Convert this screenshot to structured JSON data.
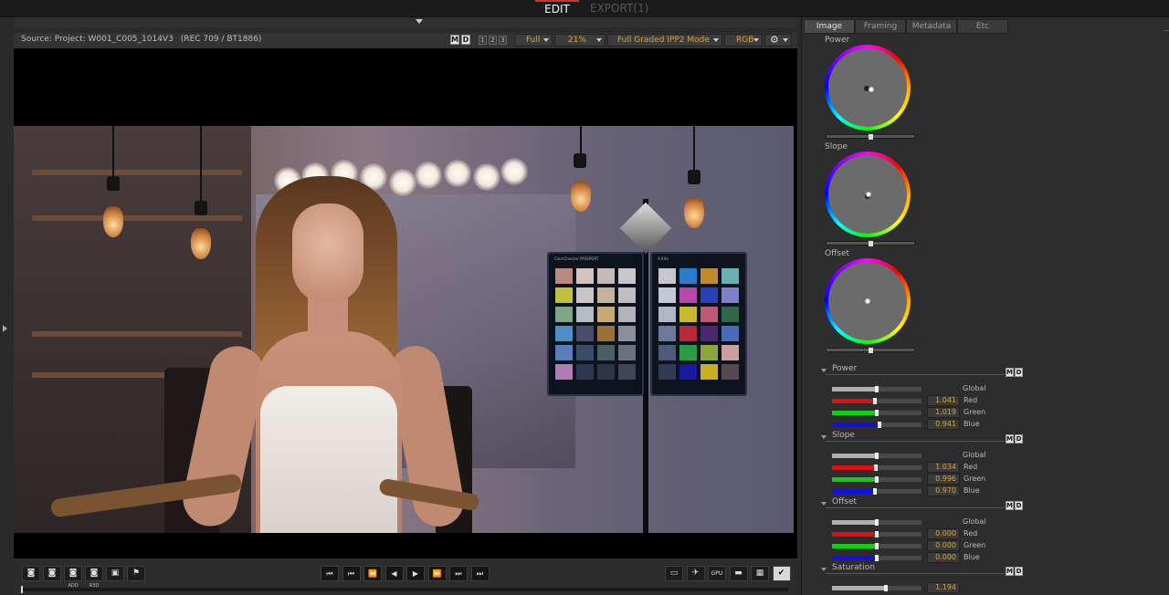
{
  "top": {
    "edit_label": "EDIT",
    "export_label": "EXPORT(1)"
  },
  "viewer_header": {
    "source_label": "Source: Project: W001_C005_1014V3",
    "color_space": "(REC 709 / BT1886)",
    "m_label": "M",
    "d_label": "D",
    "nums": [
      "1",
      "2",
      "3"
    ],
    "res_value": "Full",
    "zoom_value": "21%",
    "mode_value": "Full Graded IPP2 Mode",
    "channel_value": "RGB",
    "gear_icon": "gear-icon"
  },
  "checker_colors_left": [
    "#b78a80",
    "#d6c3bd",
    "#c9b9b6",
    "#c8c6c9",
    "#c2c13e",
    "#c8c4c8",
    "#c6b29a",
    "#c1bec0",
    "#7da686",
    "#b9bbc4",
    "#c4aa74",
    "#b2b4b8",
    "#4b8fc4",
    "#4a4d6a",
    "#9a7038",
    "#8a8e96",
    "#5a7fb8",
    "#3a4c68",
    "#4a6060",
    "#6a7280",
    "#b07cb4",
    "#2a3850",
    "#303648",
    "#3e4658"
  ],
  "checker_colors_right": [
    "#c8c6cc",
    "#2a7cc8",
    "#c08a28",
    "#6ab0b0",
    "#c2c8d4",
    "#b848a8",
    "#2a40b8",
    "#8080c8",
    "#b0b8c8",
    "#c8b830",
    "#c05878",
    "#2e6848",
    "#6e7898",
    "#b82a3a",
    "#4a2870",
    "#4a6cb8",
    "#4e5a78",
    "#2a9a48",
    "#8aa83a",
    "#c8a0a0",
    "#303a52",
    "#1a1aa0",
    "#c8b020",
    "#5a4850"
  ],
  "checker_labels": [
    "ColorChecker PASSPORT",
    "X-Rite"
  ],
  "transport": {
    "left_buttons": [
      {
        "icon": "snapshot-icon",
        "label": ""
      },
      {
        "icon": "camera-icon",
        "label": ""
      },
      {
        "icon": "camera-add-icon",
        "label": "ADD"
      },
      {
        "icon": "camera-r3d-icon",
        "label": "R3D"
      },
      {
        "icon": "frame-icon",
        "label": ""
      },
      {
        "icon": "flag-icon",
        "label": ""
      }
    ],
    "play_glyphs": [
      "⏮",
      "⏮",
      "⏪",
      "◀",
      "▶",
      "⏩",
      "⏭",
      "⏭"
    ],
    "right_buttons": [
      {
        "icon": "monitor-icon",
        "glyph": "▭"
      },
      {
        "icon": "rocket-icon",
        "glyph": "✈"
      },
      {
        "icon": "gpu-icon",
        "glyph": "GPU"
      },
      {
        "icon": "ruler-icon",
        "glyph": "▬"
      },
      {
        "icon": "keyboard-icon",
        "glyph": "▦"
      },
      {
        "icon": "checklist-icon",
        "glyph": "✔"
      }
    ]
  },
  "panel": {
    "tabs": [
      "Image",
      "Framing",
      "Metadata",
      "Etc"
    ],
    "wheels": [
      {
        "label": "Power"
      },
      {
        "label": "Slope"
      },
      {
        "label": "Offset"
      }
    ],
    "sections": [
      {
        "title": "Power",
        "global_label": "Global",
        "rows": [
          {
            "name": "Red",
            "value": "1.041",
            "color": "#e01010",
            "level": 0.48
          },
          {
            "name": "Green",
            "value": "1.019",
            "color": "#10d010",
            "level": 0.5
          },
          {
            "name": "Blue",
            "value": "0.941",
            "color": "#1010e0",
            "level": 0.53
          }
        ]
      },
      {
        "title": "Slope",
        "global_label": "Global",
        "rows": [
          {
            "name": "Red",
            "value": "1.034",
            "color": "#e01010",
            "level": 0.49
          },
          {
            "name": "Green",
            "value": "0.996",
            "color": "#10d010",
            "level": 0.5
          },
          {
            "name": "Blue",
            "value": "0.970",
            "color": "#1010e0",
            "level": 0.48
          }
        ]
      },
      {
        "title": "Offset",
        "global_label": "Global",
        "rows": [
          {
            "name": "Red",
            "value": "0.000",
            "color": "#e01010",
            "level": 0.5
          },
          {
            "name": "Green",
            "value": "0.000",
            "color": "#10d010",
            "level": 0.5
          },
          {
            "name": "Blue",
            "value": "0.000",
            "color": "#1010e0",
            "level": 0.5
          }
        ]
      }
    ],
    "saturation": {
      "title": "Saturation",
      "value": "1.194"
    }
  }
}
